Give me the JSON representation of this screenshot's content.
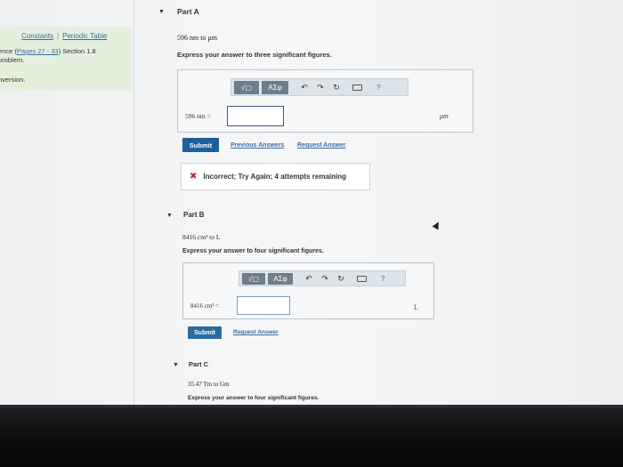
{
  "sidebar": {
    "constants_link": "Constants",
    "separator": "|",
    "periodic_link": "Periodic Table",
    "ref_prefix": "ence (",
    "ref_link": "Pages 27 - 33",
    "ref_suffix": ") Section 1.8",
    "ref_line2": "problem.",
    "conversion": "nversion."
  },
  "toolbar": {
    "templates_label": "√▢",
    "symbols_label": "ΑΣφ",
    "undo_icon": "undo-icon",
    "redo_icon": "redo-icon",
    "reset_icon": "reset-icon",
    "keyboard_icon": "keyboard-icon",
    "help_label": "?"
  },
  "part_a": {
    "title": "Part A",
    "prompt": "596 nm to μm",
    "instruction": "Express your answer to three significant figures.",
    "eq_label": "596 nm =",
    "answer_value": "",
    "unit": "μm",
    "submit_label": "Submit",
    "previous_answers": "Previous Answers",
    "request_answer": "Request Answer",
    "feedback": "Incorrect; Try Again; 4 attempts remaining"
  },
  "part_b": {
    "title": "Part B",
    "prompt": "8416 cm³ to L",
    "instruction": "Express your answer to four significant figures.",
    "eq_label": "8416 cm³ =",
    "answer_value": "",
    "unit": "L",
    "submit_label": "Submit",
    "request_answer": "Request Answer"
  },
  "part_c": {
    "title": "Part C",
    "prompt": "35.47 Tm to Gm",
    "instruction": "Express your answer to four significant figures."
  },
  "colors": {
    "submit": "#1d5f9a",
    "link": "#3a6ea5",
    "error": "#c8202b",
    "sidebar_bg": "#e4f0dd"
  }
}
